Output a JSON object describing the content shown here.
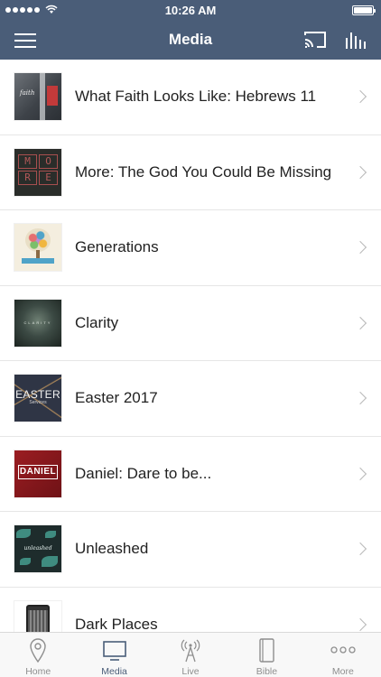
{
  "status_bar": {
    "time": "10:26 AM"
  },
  "nav": {
    "title": "Media"
  },
  "media_list": [
    {
      "title": "What Faith Looks Like: Hebrews 11",
      "thumb_text": "faith"
    },
    {
      "title": "More: The God You Could Be Missing",
      "thumb_letters": [
        "M",
        "O",
        "R",
        "E"
      ]
    },
    {
      "title": "Generations"
    },
    {
      "title": "Clarity",
      "thumb_text": "CLARITY"
    },
    {
      "title": "Easter 2017",
      "thumb_text": "EASTER",
      "thumb_sub": "Services"
    },
    {
      "title": "Daniel: Dare to be...",
      "thumb_text": "DANIEL"
    },
    {
      "title": "Unleashed",
      "thumb_text": "unleashed"
    },
    {
      "title": "Dark Places"
    }
  ],
  "tabs": [
    {
      "label": "Home",
      "icon": "location-pin-icon",
      "active": false
    },
    {
      "label": "Media",
      "icon": "monitor-icon",
      "active": true
    },
    {
      "label": "Live",
      "icon": "broadcast-tower-icon",
      "active": false
    },
    {
      "label": "Bible",
      "icon": "book-icon",
      "active": false
    },
    {
      "label": "More",
      "icon": "more-dots-icon",
      "active": false
    }
  ],
  "colors": {
    "header": "#4a5d78",
    "active_tab": "#4a5d78",
    "inactive_tab": "#8e8e8e",
    "chevron": "#b8b8b8"
  }
}
